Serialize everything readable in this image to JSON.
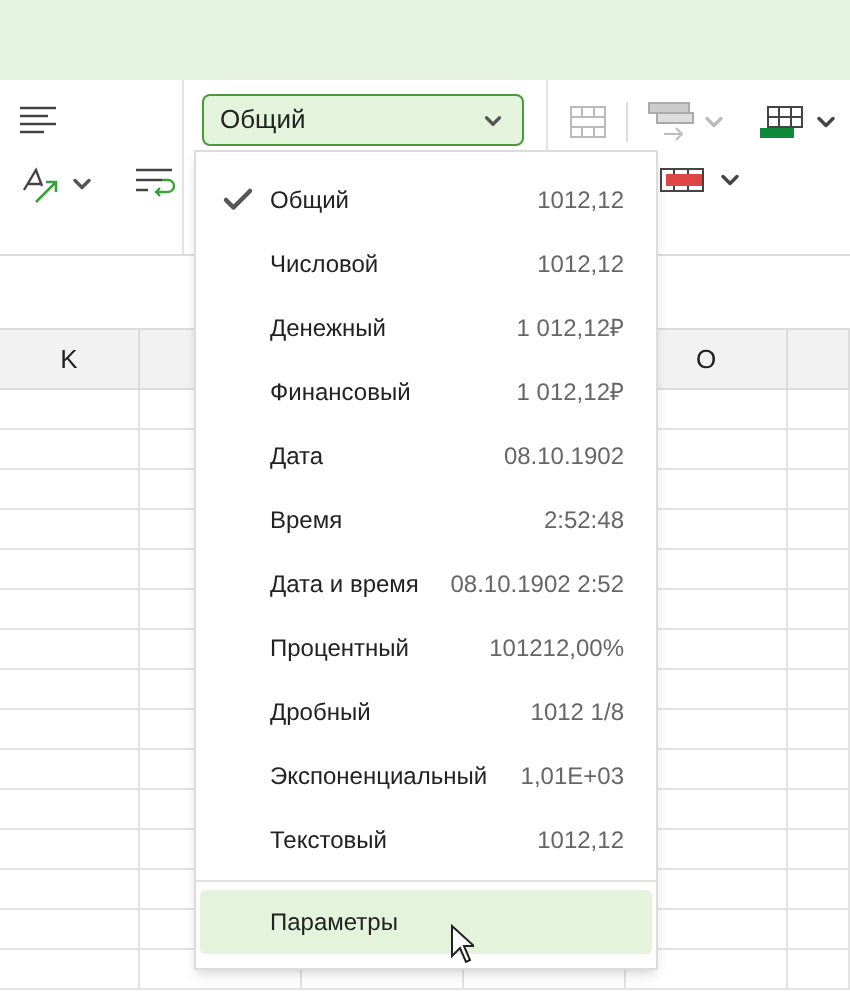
{
  "format_select": {
    "value": "Общий"
  },
  "column_headers": [
    "K",
    "O"
  ],
  "format_menu": {
    "items": [
      {
        "label": "Общий",
        "sample": "1012,12",
        "checked": true
      },
      {
        "label": "Числовой",
        "sample": "1012,12",
        "checked": false
      },
      {
        "label": "Денежный",
        "sample": "1 012,12₽",
        "checked": false
      },
      {
        "label": "Финансовый",
        "sample": "1 012,12₽",
        "checked": false
      },
      {
        "label": "Дата",
        "sample": "08.10.1902",
        "checked": false
      },
      {
        "label": "Время",
        "sample": "2:52:48",
        "checked": false
      },
      {
        "label": "Дата и время",
        "sample": "08.10.1902 2:52",
        "checked": false
      },
      {
        "label": "Процентный",
        "sample": "101212,00%",
        "checked": false
      },
      {
        "label": "Дробный",
        "sample": "1012 1/8",
        "checked": false
      },
      {
        "label": "Экспоненциальный",
        "sample": "1,01E+03",
        "checked": false
      },
      {
        "label": "Текстовый",
        "sample": "1012,12",
        "checked": false
      }
    ],
    "footer": {
      "label": "Параметры",
      "highlighted": true
    }
  }
}
